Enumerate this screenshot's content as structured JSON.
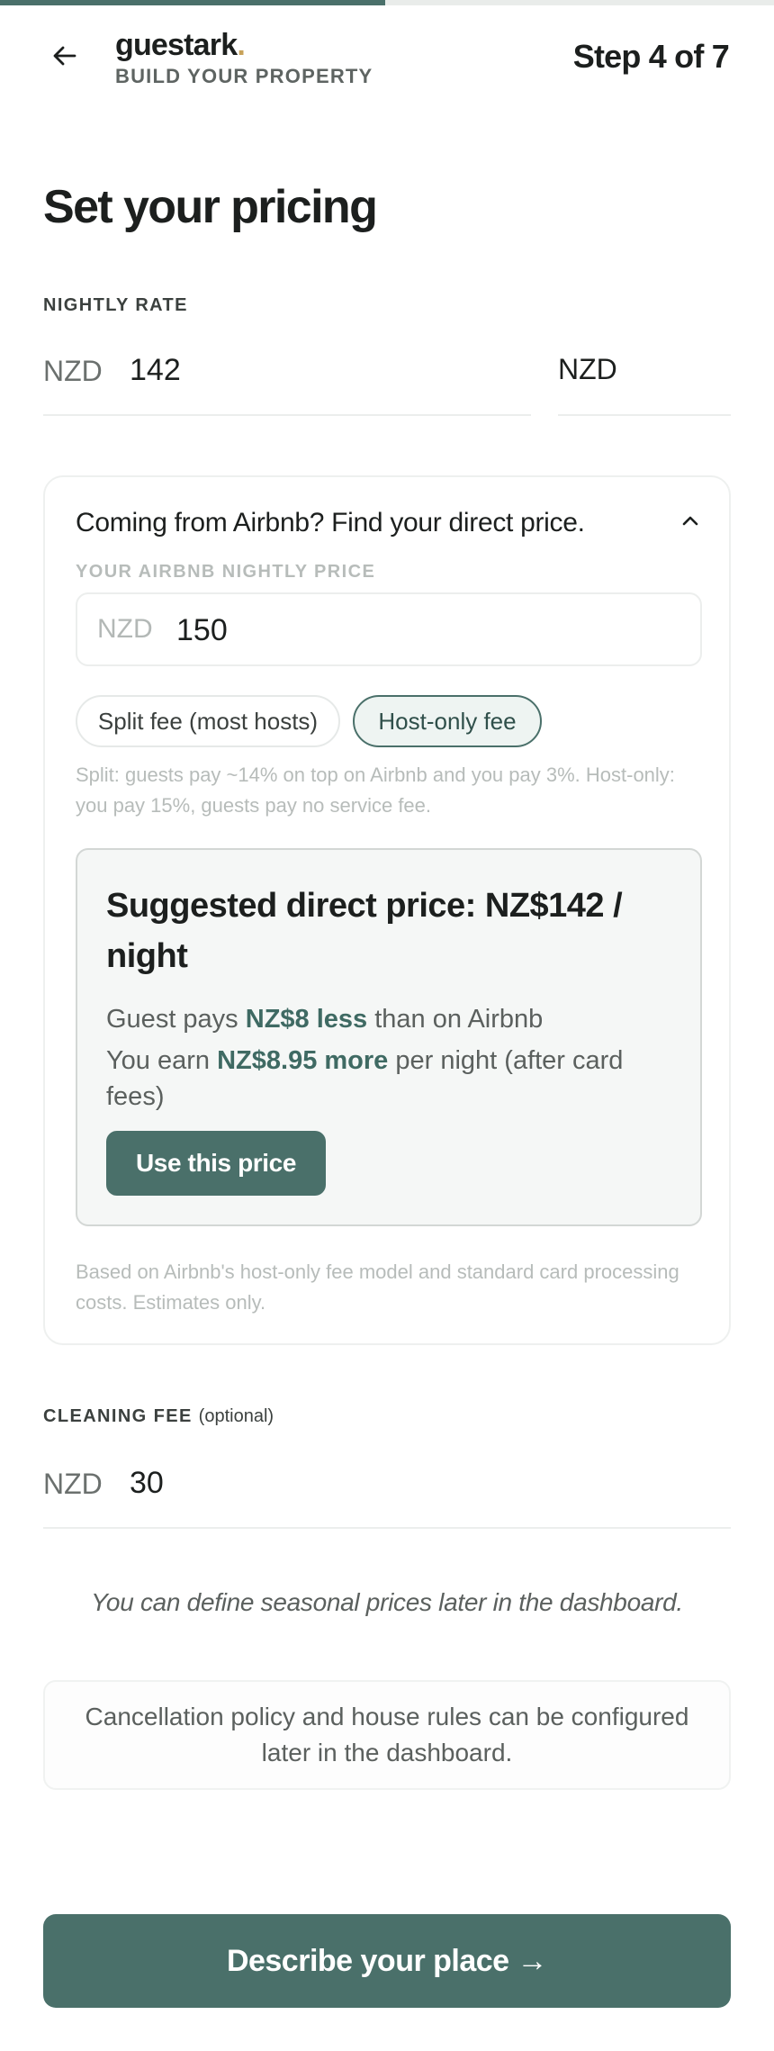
{
  "progress": {
    "fraction": 0.4977
  },
  "header": {
    "brand_name": "guestark",
    "brand_dot": ".",
    "brand_sub": "BUILD YOUR PROPERTY",
    "step": "Step 4 of 7"
  },
  "title": "Set your pricing",
  "nightly": {
    "label": "NIGHTLY RATE",
    "prefix": "NZD",
    "value": "142",
    "currency": "NZD"
  },
  "airbnb": {
    "question": "Coming from Airbnb? Find your direct price.",
    "sublabel": "YOUR AIRBNB NIGHTLY PRICE",
    "prefix": "NZD",
    "value": "150",
    "pill_split": "Split fee (most hosts)",
    "pill_host": "Host-only fee",
    "fee_note": "Split: guests pay ~14% on top on Airbnb and you pay 3%. Host-only: you pay 15%, guests pay no service fee.",
    "suggest_title": "Suggested direct price: NZ$142 / night",
    "guest_pre": "Guest pays ",
    "guest_amt": "NZ$8 less",
    "guest_post": " than on Airbnb",
    "earn_pre": "You earn ",
    "earn_amt": "NZ$8.95 more",
    "earn_post": " per night (after card fees)",
    "use_button": "Use this price",
    "estimate_note": "Based on Airbnb's host-only fee model and standard card processing costs. Estimates only."
  },
  "cleaning": {
    "label": "CLEANING FEE",
    "optional": "(optional)",
    "prefix": "NZD",
    "value": "30"
  },
  "seasonal_note": "You can define seasonal prices later in the dashboard.",
  "policy_note": "Cancellation policy and house rules can be configured later in the dashboard.",
  "cta": "Describe your place →",
  "colors": {
    "accent": "#4a706a",
    "brand_dot": "#c8a25a"
  }
}
